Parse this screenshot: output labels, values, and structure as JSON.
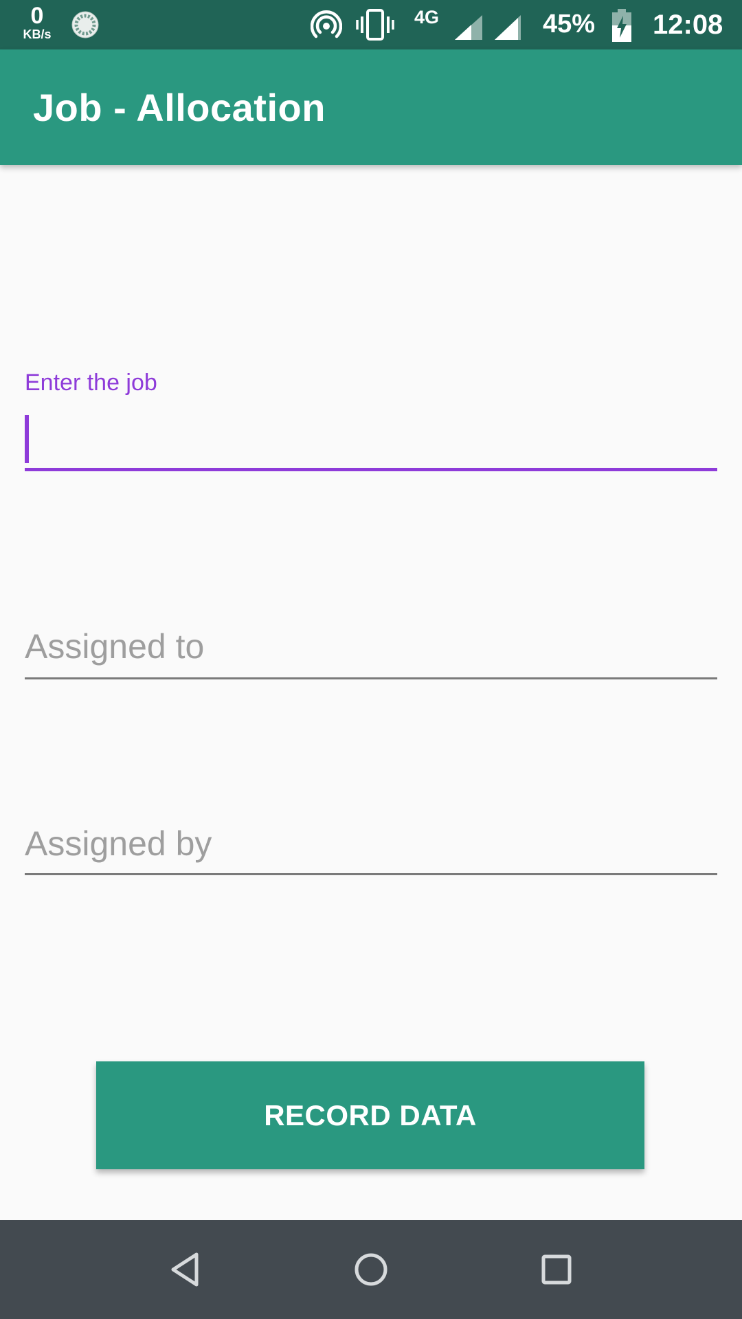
{
  "status_bar": {
    "data_rate_value": "0",
    "data_rate_unit": "KB/s",
    "network_type": "4G",
    "battery_percent": "45%",
    "time": "12:08",
    "icons": [
      "sync-icon",
      "hotspot-icon",
      "vibrate-icon",
      "signal-icon",
      "signal-icon",
      "battery-charging-icon"
    ]
  },
  "app_bar": {
    "title": "Job - Allocation"
  },
  "form": {
    "job_field": {
      "label": "Enter the job",
      "value": ""
    },
    "assigned_to_field": {
      "placeholder": "Assigned to",
      "value": ""
    },
    "assigned_by_field": {
      "placeholder": "Assigned by",
      "value": ""
    },
    "record_button_label": "RECORD DATA"
  },
  "nav_bar": {
    "icons": [
      "back-icon",
      "home-icon",
      "recents-icon"
    ]
  },
  "colors": {
    "status_bar": "#206456",
    "primary": "#2a9880",
    "accent": "#8e3bd9",
    "background": "#fafafa",
    "nav_bar": "#434a50",
    "hint_text": "#9e9e9e"
  }
}
